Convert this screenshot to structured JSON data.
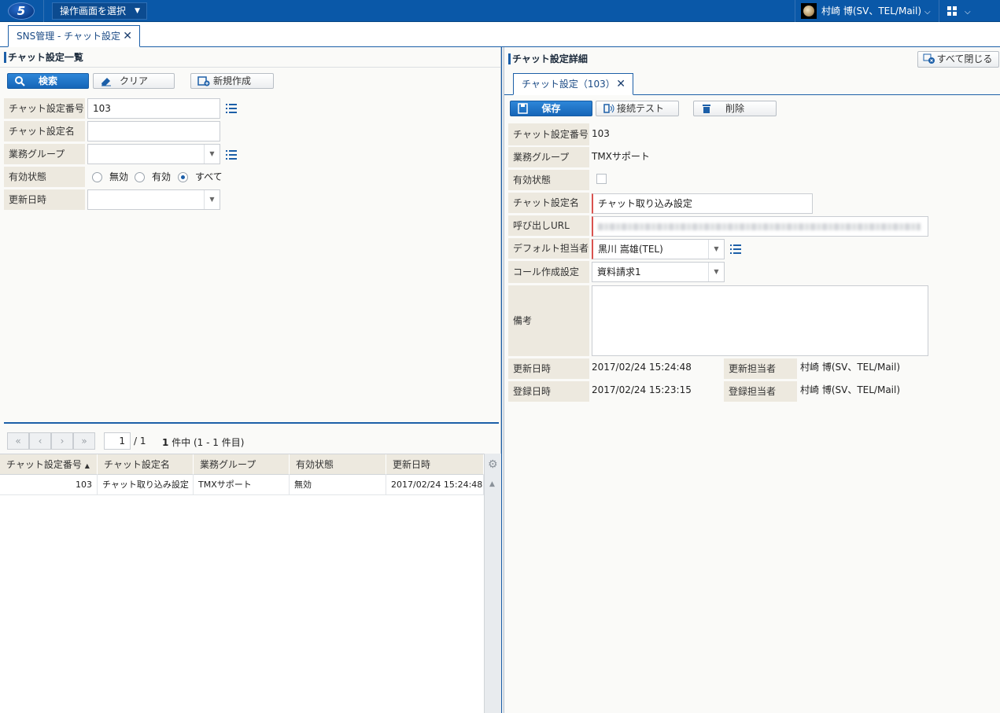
{
  "topbar": {
    "logo_text": "5",
    "screen_select_label": "操作画面を選択",
    "user_name": "村崎 博(SV、TEL/Mail)"
  },
  "main_tab": {
    "label": "SNS管理 - チャット設定"
  },
  "list_panel": {
    "title": "チャット設定一覧",
    "buttons": {
      "search": "検索",
      "clear": "クリア",
      "new": "新規作成"
    },
    "fields": {
      "chat_setting_number": {
        "label": "チャット設定番号",
        "value": "103"
      },
      "chat_setting_name": {
        "label": "チャット設定名",
        "value": ""
      },
      "business_group": {
        "label": "業務グループ",
        "value": ""
      },
      "status": {
        "label": "有効状態",
        "options": [
          "無効",
          "有効",
          "すべて"
        ],
        "selected": "すべて"
      },
      "updated_at": {
        "label": "更新日時",
        "value": ""
      }
    },
    "pager": {
      "first": "«",
      "prev": "‹",
      "next": "›",
      "last": "»",
      "page": "1",
      "total_pages": "/ 1",
      "count_bold": "1",
      "count_text": "件中 (1 - 1 件目)"
    },
    "table": {
      "columns": [
        "チャット設定番号",
        "チャット設定名",
        "業務グループ",
        "有効状態",
        "更新日時"
      ],
      "sort_indicator": "▲",
      "rows": [
        [
          "103",
          "チャット取り込み設定",
          "TMXサポート",
          "無効",
          "2017/02/24 15:24:48"
        ]
      ]
    }
  },
  "detail_panel": {
    "title": "チャット設定詳細",
    "close_all": "すべて閉じる",
    "tab_label": "チャット設定（103）",
    "buttons": {
      "save": "保存",
      "connection_test": "接続テスト",
      "delete": "削除"
    },
    "fields": {
      "chat_setting_number": {
        "label": "チャット設定番号",
        "value": "103"
      },
      "business_group": {
        "label": "業務グループ",
        "value": "TMXサポート"
      },
      "status": {
        "label": "有効状態",
        "checked": false
      },
      "chat_setting_name": {
        "label": "チャット設定名",
        "value": "チャット取り込み設定"
      },
      "call_url": {
        "label": "呼び出しURL"
      },
      "default_person": {
        "label": "デフォルト担当者",
        "value": "黒川 嵩雄(TEL)"
      },
      "call_creation": {
        "label": "コール作成設定",
        "value": "資料請求1"
      },
      "notes": {
        "label": "備考",
        "value": ""
      },
      "updated_at": {
        "label": "更新日時",
        "value": "2017/02/24 15:24:48"
      },
      "updated_by": {
        "label": "更新担当者",
        "value": "村崎 博(SV、TEL/Mail)"
      },
      "created_at": {
        "label": "登録日時",
        "value": "2017/02/24 15:23:15"
      },
      "created_by": {
        "label": "登録担当者",
        "value": "村崎 博(SV、TEL/Mail)"
      }
    }
  },
  "colors": {
    "brand": "#0a58a8",
    "accent": "#1c5fa8",
    "label_bg": "#ede9df",
    "required": "#d9534f"
  }
}
